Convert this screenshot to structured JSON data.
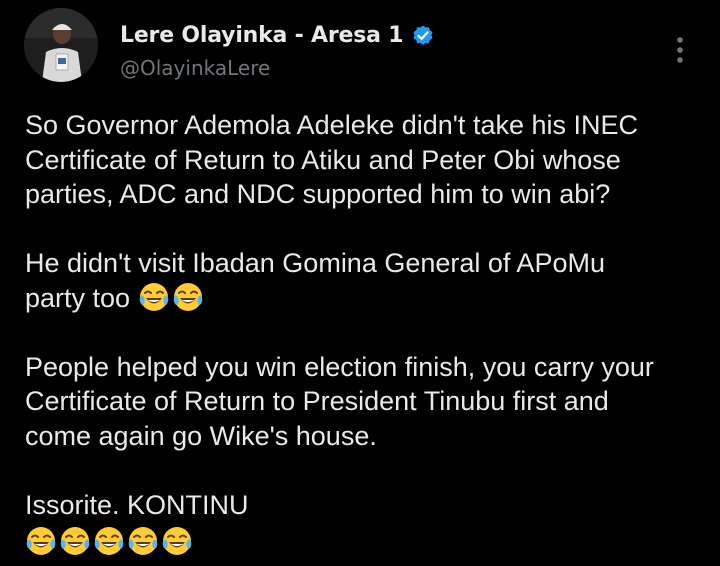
{
  "author": {
    "display_name": "Lere Olayinka - Aresa 1",
    "handle": "@OlayinkaLere",
    "verified": true,
    "avatar_icon": "profile-photo"
  },
  "more_icon": "more-vertical-icon",
  "colors": {
    "background": "#000000",
    "text": "#e7e9ea",
    "secondary_text": "#71767b",
    "verified_badge": "#1d9bf0"
  },
  "tweet": {
    "paragraphs": [
      {
        "lines": [
          "So Governor Ademola Adeleke didn't take his INEC",
          "Certificate of Return to Atiku and Peter Obi whose",
          "parties, ADC and NDC supported him to win abi?"
        ]
      },
      {
        "lines": [
          "He didn't visit Ibadan Gomina General of APoMu",
          "party too"
        ],
        "trailing_emoji_count": 2,
        "emoji": "tears-of-joy-emoji"
      },
      {
        "lines": [
          "People helped you win election finish, you carry your",
          "Certificate of Return to President Tinubu first and",
          "come again go Wike's house."
        ]
      },
      {
        "lines": [
          "Issorite. KONTINU"
        ],
        "emoji_line_count": 5,
        "emoji": "tears-of-joy-emoji"
      }
    ]
  }
}
